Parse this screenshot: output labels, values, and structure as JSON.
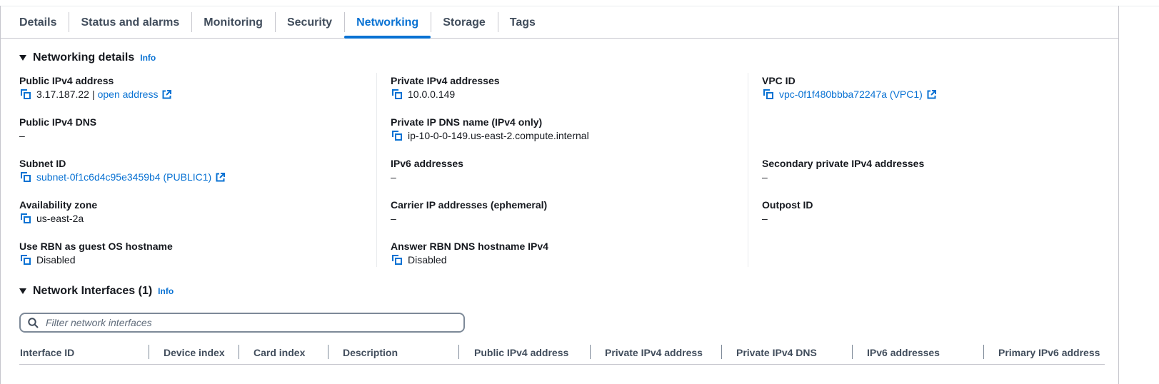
{
  "tabs": [
    "Details",
    "Status and alarms",
    "Monitoring",
    "Security",
    "Networking",
    "Storage",
    "Tags"
  ],
  "active_tab": "Networking",
  "colors": {
    "link": "#0972d3",
    "text": "#16191f",
    "border": "#c6c6cd"
  },
  "networking_details": {
    "title": "Networking details",
    "info": "Info",
    "public_ipv4": {
      "label": "Public IPv4 address",
      "value": "3.17.187.22",
      "separator": "|",
      "link": "open address"
    },
    "private_ipv4": {
      "label": "Private IPv4 addresses",
      "value": "10.0.0.149"
    },
    "vpc_id": {
      "label": "VPC ID",
      "value": "vpc-0f1f480bbba72247a (VPC1)"
    },
    "public_dns": {
      "label": "Public IPv4 DNS",
      "value": "–"
    },
    "private_dns": {
      "label": "Private IP DNS name (IPv4 only)",
      "value": "ip-10-0-0-149.us-east-2.compute.internal"
    },
    "subnet_id": {
      "label": "Subnet ID",
      "value": "subnet-0f1c6d4c95e3459b4 (PUBLIC1)"
    },
    "ipv6": {
      "label": "IPv6 addresses",
      "value": "–"
    },
    "secondary_private": {
      "label": "Secondary private IPv4 addresses",
      "value": "–"
    },
    "az": {
      "label": "Availability zone",
      "value": "us-east-2a"
    },
    "carrier_ip": {
      "label": "Carrier IP addresses (ephemeral)",
      "value": "–"
    },
    "outpost": {
      "label": "Outpost ID",
      "value": "–"
    },
    "rbn_hostname": {
      "label": "Use RBN as guest OS hostname",
      "value": "Disabled"
    },
    "rbn_dns": {
      "label": "Answer RBN DNS hostname IPv4",
      "value": "Disabled"
    }
  },
  "network_interfaces": {
    "title": "Network Interfaces (1)",
    "info": "Info",
    "search_placeholder": "Filter network interfaces",
    "columns": [
      "Interface ID",
      "Device index",
      "Card index",
      "Description",
      "Public IPv4 address",
      "Private IPv4 address",
      "Private IPv4 DNS",
      "IPv6 addresses",
      "Primary IPv6 address"
    ]
  }
}
